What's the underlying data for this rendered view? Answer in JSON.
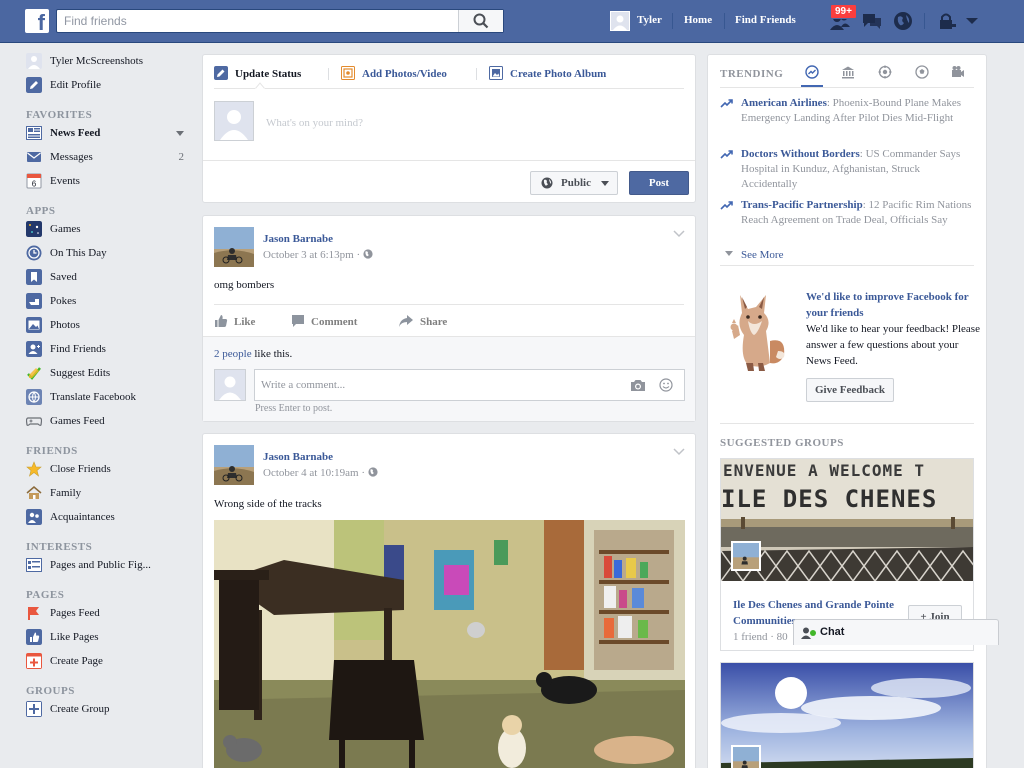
{
  "topbar": {
    "logo": "f",
    "search_placeholder": "Find friends",
    "user_name": "Tyler",
    "home": "Home",
    "find_friends": "Find Friends",
    "friend_requests_badge": "99+"
  },
  "sidebar": {
    "user_name": "Tyler McScreenshots",
    "edit_profile": "Edit Profile",
    "sections": {
      "favorites": "FAVORITES",
      "apps": "APPS",
      "friends": "FRIENDS",
      "interests": "INTERESTS",
      "pages": "PAGES",
      "groups": "GROUPS"
    },
    "favorites": [
      {
        "label": "News Feed"
      },
      {
        "label": "Messages",
        "count": "2"
      },
      {
        "label": "Events"
      }
    ],
    "apps": [
      {
        "label": "Games"
      },
      {
        "label": "On This Day"
      },
      {
        "label": "Saved"
      },
      {
        "label": "Pokes"
      },
      {
        "label": "Photos"
      },
      {
        "label": "Find Friends"
      },
      {
        "label": "Suggest Edits"
      },
      {
        "label": "Translate Facebook"
      },
      {
        "label": "Games Feed"
      }
    ],
    "friends": [
      {
        "label": "Close Friends"
      },
      {
        "label": "Family"
      },
      {
        "label": "Acquaintances"
      }
    ],
    "interests": [
      {
        "label": "Pages and Public Fig..."
      }
    ],
    "pages": [
      {
        "label": "Pages Feed"
      },
      {
        "label": "Like Pages"
      },
      {
        "label": "Create Page"
      }
    ],
    "groups": [
      {
        "label": "Create Group"
      }
    ],
    "events_day": "6"
  },
  "composer": {
    "tab_status": "Update Status",
    "tab_photos": "Add Photos/Video",
    "tab_album": "Create Photo Album",
    "placeholder": "What's on your mind?",
    "privacy": "Public",
    "post": "Post"
  },
  "posts": [
    {
      "author": "Jason Barnabe",
      "time": "October 3 at 6:13pm · ",
      "text": "omg bombers",
      "like": "Like",
      "comment": "Comment",
      "share": "Share",
      "likes_link": "2 people",
      "likes_rest": " like this.",
      "comment_placeholder": "Write a comment...",
      "hint": "Press Enter to post."
    },
    {
      "author": "Jason Barnabe",
      "time": "October 4 at 10:19am · ",
      "text": "Wrong side of the tracks"
    }
  ],
  "trending": {
    "title": "TRENDING",
    "items": [
      {
        "topic": "American Airlines",
        "desc": ": Phoenix-Bound Plane Makes Emergency Landing After Pilot Dies Mid-Flight"
      },
      {
        "topic": "Doctors Without Borders",
        "desc": ": US Commander Says Hospital in Kunduz, Afghanistan, Struck Accidentally"
      },
      {
        "topic": "Trans-Pacific Partnership",
        "desc": ": 12 Pacific Rim Nations Reach Agreement on Trade Deal, Officials Say"
      }
    ],
    "see_more": "See More"
  },
  "feedback": {
    "title": "We'd like to improve Facebook for your friends",
    "desc": "We'd like to hear your feedback! Please answer a few questions about your News Feed.",
    "button": "Give Feedback"
  },
  "suggested_groups": {
    "title": "SUGGESTED GROUPS",
    "sign_line1": "ENVENUE A WELCOME T",
    "sign_line2": "ILE DES CHENES",
    "group_name": "Ile Des Chenes and Grande Pointe Communities",
    "meta": "1 friend · 80",
    "join": "Join"
  },
  "chat": {
    "label": "Chat"
  },
  "colors": {
    "brand_blue": "#4b67a1",
    "link_blue": "#3b5998",
    "badge_red": "#fa3e3e",
    "online_green": "#42b72a"
  }
}
